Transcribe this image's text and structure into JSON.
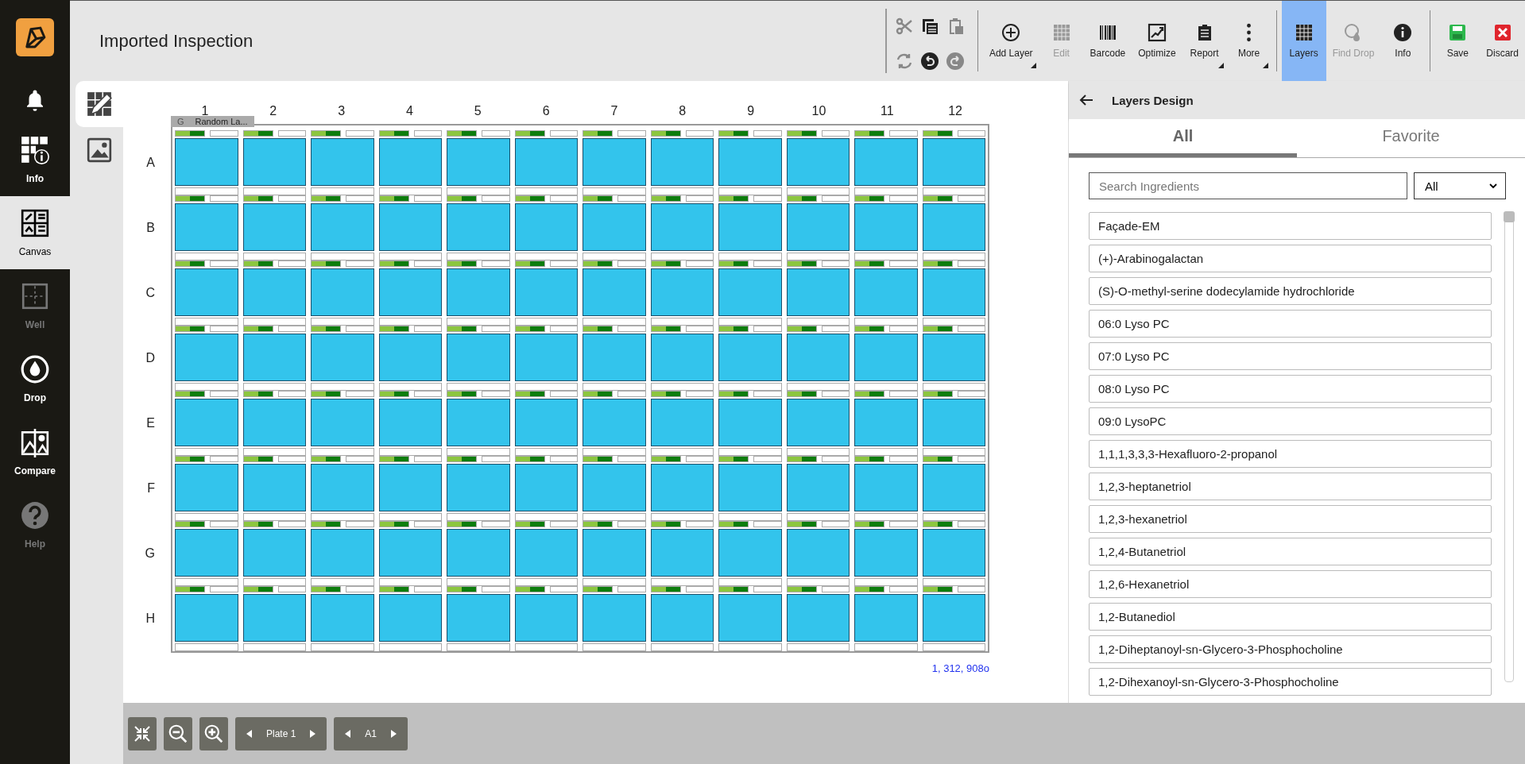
{
  "sidebar": {
    "items": [
      {
        "label": "Info",
        "selected": false,
        "disabled": false
      },
      {
        "label": "Canvas",
        "selected": true,
        "disabled": false
      },
      {
        "label": "Well",
        "selected": false,
        "disabled": true
      },
      {
        "label": "Drop",
        "selected": false,
        "disabled": false
      },
      {
        "label": "Compare",
        "selected": false,
        "disabled": false
      },
      {
        "label": "Help",
        "selected": false,
        "disabled": true
      }
    ]
  },
  "header": {
    "title": "Imported Inspection"
  },
  "toolbar": {
    "edit_tools": [
      {
        "disabled": true
      },
      {
        "disabled": false
      },
      {
        "disabled": true
      },
      {
        "disabled": true
      },
      {
        "disabled": false
      },
      {
        "disabled": true
      }
    ],
    "actions": [
      {
        "label": "Add Layer",
        "kind": "tool",
        "disabled": false,
        "selected": false,
        "dropdown": true
      },
      {
        "label": "Edit",
        "kind": "tool",
        "disabled": true,
        "selected": false,
        "dropdown": false
      },
      {
        "label": "Barcode",
        "kind": "tool",
        "disabled": false,
        "selected": false,
        "dropdown": false
      },
      {
        "label": "Optimize",
        "kind": "tool",
        "disabled": false,
        "selected": false,
        "dropdown": false
      },
      {
        "label": "Report",
        "kind": "tool",
        "disabled": false,
        "selected": false,
        "dropdown": true
      },
      {
        "label": "More",
        "kind": "tool",
        "disabled": false,
        "selected": false,
        "dropdown": true
      },
      {
        "label": "Layers",
        "kind": "view",
        "disabled": false,
        "selected": true,
        "dropdown": false
      },
      {
        "label": "Find Drop",
        "kind": "view",
        "disabled": true,
        "selected": false,
        "dropdown": false
      },
      {
        "label": "Info",
        "kind": "view",
        "disabled": false,
        "selected": false,
        "dropdown": false
      },
      {
        "label": "Save",
        "kind": "commit",
        "disabled": false,
        "selected": false,
        "dropdown": false
      },
      {
        "label": "Discard",
        "kind": "commit",
        "disabled": false,
        "selected": false,
        "dropdown": false
      }
    ]
  },
  "view_tools": [
    {
      "selected": true
    },
    {
      "selected": false
    }
  ],
  "plate": {
    "columns": [
      "1",
      "2",
      "3",
      "4",
      "5",
      "6",
      "7",
      "8",
      "9",
      "10",
      "11",
      "12"
    ],
    "rows": [
      "A",
      "B",
      "C",
      "D",
      "E",
      "F",
      "G",
      "H"
    ],
    "group_tag": {
      "letter": "G",
      "label": "Random La..."
    },
    "coordinates": "1, 312, 908o"
  },
  "bottom_bar": {
    "plate_pager": "Plate 1",
    "well_pager": "A1"
  },
  "panel": {
    "title": "Layers Design",
    "tabs": [
      {
        "label": "All",
        "selected": true
      },
      {
        "label": "Favorite",
        "selected": false
      }
    ],
    "search": {
      "placeholder": "Search Ingredients"
    },
    "filter": "All",
    "ingredients": [
      "Façade-EM",
      "(+)-Arabinogalactan",
      "(S)-O-methyl-serine dodecylamide hydrochloride",
      "06:0 Lyso PC",
      "07:0 Lyso PC",
      "08:0 Lyso PC",
      "09:0 LysoPC",
      "1,1,1,3,3,3-Hexafluoro-2-propanol",
      "1,2,3-heptanetriol",
      "1,2,3-hexanetriol",
      "1,2,4-Butanetriol",
      "1,2,6-Hexanetriol",
      "1,2-Butanediol",
      "1,2-Diheptanoyl-sn-Glycero-3-Phosphocholine",
      "1,2-Dihexanoyl-sn-Glycero-3-Phosphocholine"
    ]
  }
}
